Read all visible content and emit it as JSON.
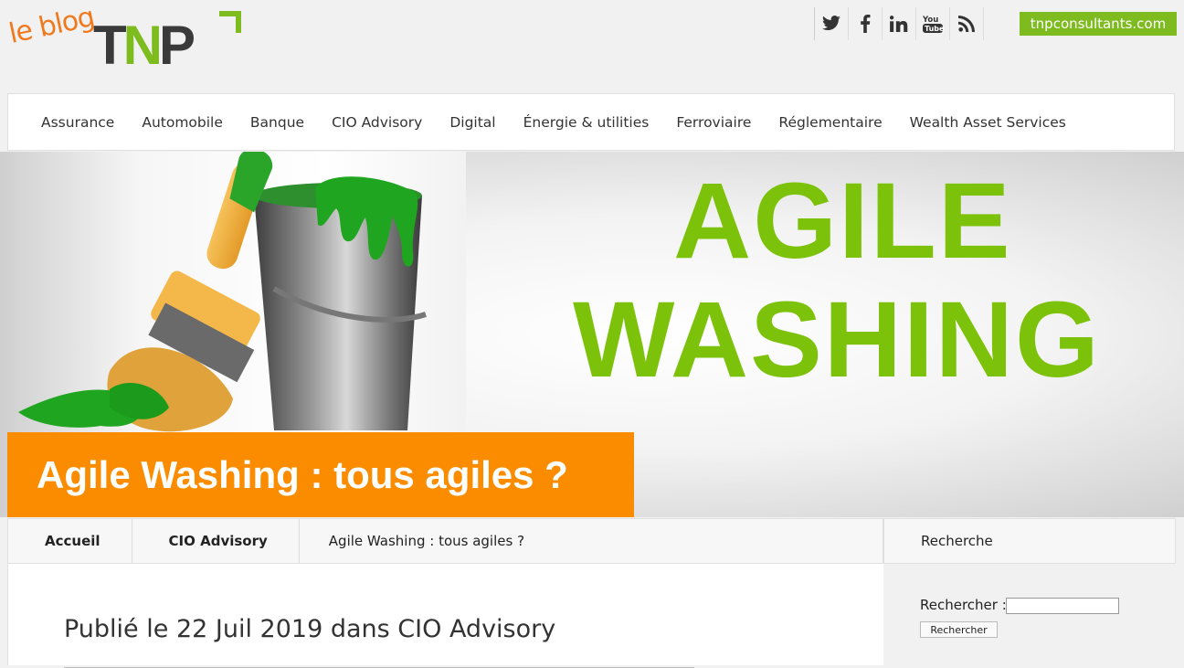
{
  "header": {
    "logo_prefix": "le blog",
    "logo_brand_t": "T",
    "logo_brand_n": "N",
    "logo_brand_p": "P",
    "social": [
      "twitter-icon",
      "facebook-icon",
      "linkedin-icon",
      "youtube-icon",
      "rss-icon"
    ],
    "site_link": "tnpconsultants.com"
  },
  "nav": {
    "items": [
      "Assurance",
      "Automobile",
      "Banque",
      "CIO Advisory",
      "Digital",
      "Énergie & utilities",
      "Ferroviaire",
      "Réglementaire",
      "Wealth Asset Services"
    ]
  },
  "hero": {
    "image_line1": "AGILE",
    "image_line2": "WASHING",
    "title": "Agile Washing : tous agiles ?"
  },
  "breadcrumb": {
    "home": "Accueil",
    "category": "CIO Advisory",
    "current": "Agile Washing : tous agiles ?"
  },
  "sidebar": {
    "heading": "Recherche",
    "search_label": "Rechercher :",
    "search_value": "",
    "search_button": "Rechercher"
  },
  "article": {
    "published": "Publié le 22 Juil 2019 dans CIO Advisory"
  },
  "colors": {
    "accent_green": "#7dbb1e",
    "accent_orange": "#fb8c00",
    "logo_orange": "#f0791e"
  }
}
